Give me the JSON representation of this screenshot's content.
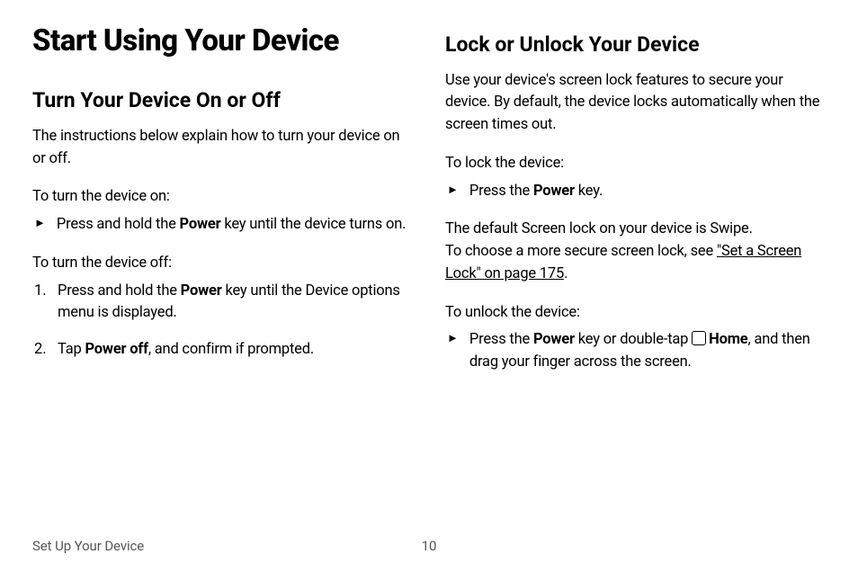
{
  "title": "Start Using Your Device",
  "left": {
    "h2": "Turn Your Device On or Off",
    "intro": "The instructions below explain how to turn your device on or off.",
    "on_lead": "To turn the device on:",
    "on_bullet_mark": "►",
    "on_bullet_pre": "Press and hold the ",
    "on_bullet_bold": "Power",
    "on_bullet_post": " key until the device turns on.",
    "off_lead": "To turn the device off:",
    "step1_num": "1.",
    "step1_pre": "Press and hold the ",
    "step1_bold": "Power",
    "step1_post": " key until the Device options menu is displayed.",
    "step2_num": "2.",
    "step2_pre": "Tap ",
    "step2_bold": "Power off",
    "step2_post": ", and confirm if prompted."
  },
  "right": {
    "h2": "Lock or Unlock Your Device",
    "intro": "Use your device's screen lock features to secure your device. By default, the device locks automatically when the screen times out.",
    "lock_lead": "To lock the device:",
    "lock_bullet_mark": "►",
    "lock_bullet_pre": "Press the ",
    "lock_bullet_bold": "Power",
    "lock_bullet_post": " key.",
    "swipe_line1": "The default Screen lock on your device is Swipe.",
    "swipe_line2_pre": "To choose a more secure screen lock, see ",
    "swipe_link": "\"Set a Screen Lock\" on page 175",
    "swipe_link_post": ".",
    "unlock_lead": "To unlock the device:",
    "unlock_bullet_mark": "►",
    "unlock_pre": "Press the ",
    "unlock_bold1": "Power",
    "unlock_mid": " key or double-tap ",
    "unlock_bold2": "Home",
    "unlock_post": ", and then drag your finger across the screen."
  },
  "footer": {
    "section": "Set Up Your Device",
    "page": "10"
  }
}
